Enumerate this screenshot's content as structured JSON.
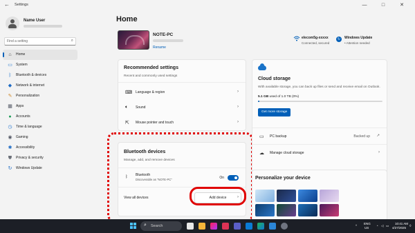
{
  "window": {
    "title": "Settings",
    "back_glyph": "←",
    "minimize_glyph": "—",
    "maximize_glyph": "□",
    "close_glyph": "✕"
  },
  "profile": {
    "name": "Name User"
  },
  "search": {
    "placeholder": "Find a setting",
    "icon": "search-icon"
  },
  "nav": {
    "items": [
      {
        "label": "Home",
        "icon": "home-icon",
        "color": "#444444"
      },
      {
        "label": "System",
        "icon": "system-icon",
        "color": "#2b7bd0"
      },
      {
        "label": "Bluetooth & devices",
        "icon": "bluetooth-icon",
        "color": "#2b7bd0"
      },
      {
        "label": "Network & internet",
        "icon": "network-icon",
        "color": "#1e6bc4"
      },
      {
        "label": "Personalization",
        "icon": "brush-icon",
        "color": "#d08a2b"
      },
      {
        "label": "Apps",
        "icon": "apps-icon",
        "color": "#555a66"
      },
      {
        "label": "Accounts",
        "icon": "accounts-icon",
        "color": "#1c9b57"
      },
      {
        "label": "Time & language",
        "icon": "clock-icon",
        "color": "#2b7bd0"
      },
      {
        "label": "Gaming",
        "icon": "gaming-icon",
        "color": "#555a66"
      },
      {
        "label": "Accessibility",
        "icon": "accessibility-icon",
        "color": "#1e6bc4"
      },
      {
        "label": "Privacy & security",
        "icon": "shield-icon",
        "color": "#6b6f78"
      },
      {
        "label": "Windows Update",
        "icon": "update-icon",
        "color": "#1e6bc4"
      }
    ]
  },
  "main": {
    "title": "Home",
    "device": {
      "name": "NOTE-PC",
      "rename": "Rename"
    },
    "status": {
      "wifi_title": "elecom5g-xxxxx",
      "wifi_sub": "Connected, secured",
      "update_title": "Windows Update",
      "update_sub": "• Attention needed"
    }
  },
  "recommended": {
    "title": "Recommended settings",
    "subtitle": "Recent and commonly used settings",
    "rows": [
      {
        "label": "Language & region",
        "icon": "language-icon"
      },
      {
        "label": "Sound",
        "icon": "speaker-icon"
      },
      {
        "label": "Mouse pointer and touch",
        "icon": "mouse-icon"
      }
    ],
    "chevron": "›"
  },
  "bluetooth": {
    "title": "Bluetooth devices",
    "subtitle": "Manage, add, and remove devices",
    "bt_label": "Bluetooth",
    "bt_sub": "Discoverable as \"NOTE-PC\"",
    "toggle_label": "On",
    "toggle_on": true,
    "view_all": "View all devices",
    "add_device": "Add device",
    "highlight_color": "#e00000"
  },
  "cloud": {
    "title": "Cloud storage",
    "desc": "With available storage, you can back up files or send and receive email on Outlook.",
    "used": "5.1 GB",
    "used_rest": "used of 1.0 TB (0%)",
    "used_fraction": 0.005,
    "get_more": "Get more storage",
    "rows": [
      {
        "label": "PC backup",
        "status": "Backed up",
        "icon": "backup-icon"
      },
      {
        "label": "Manage cloud storage",
        "icon": "cloud-manage-icon"
      }
    ]
  },
  "personalize": {
    "title": "Personalize your device"
  },
  "taskbar": {
    "search": "Search",
    "lang": "ENG",
    "region": "US",
    "time": "10:41 AM",
    "date": "4/27/2025"
  }
}
